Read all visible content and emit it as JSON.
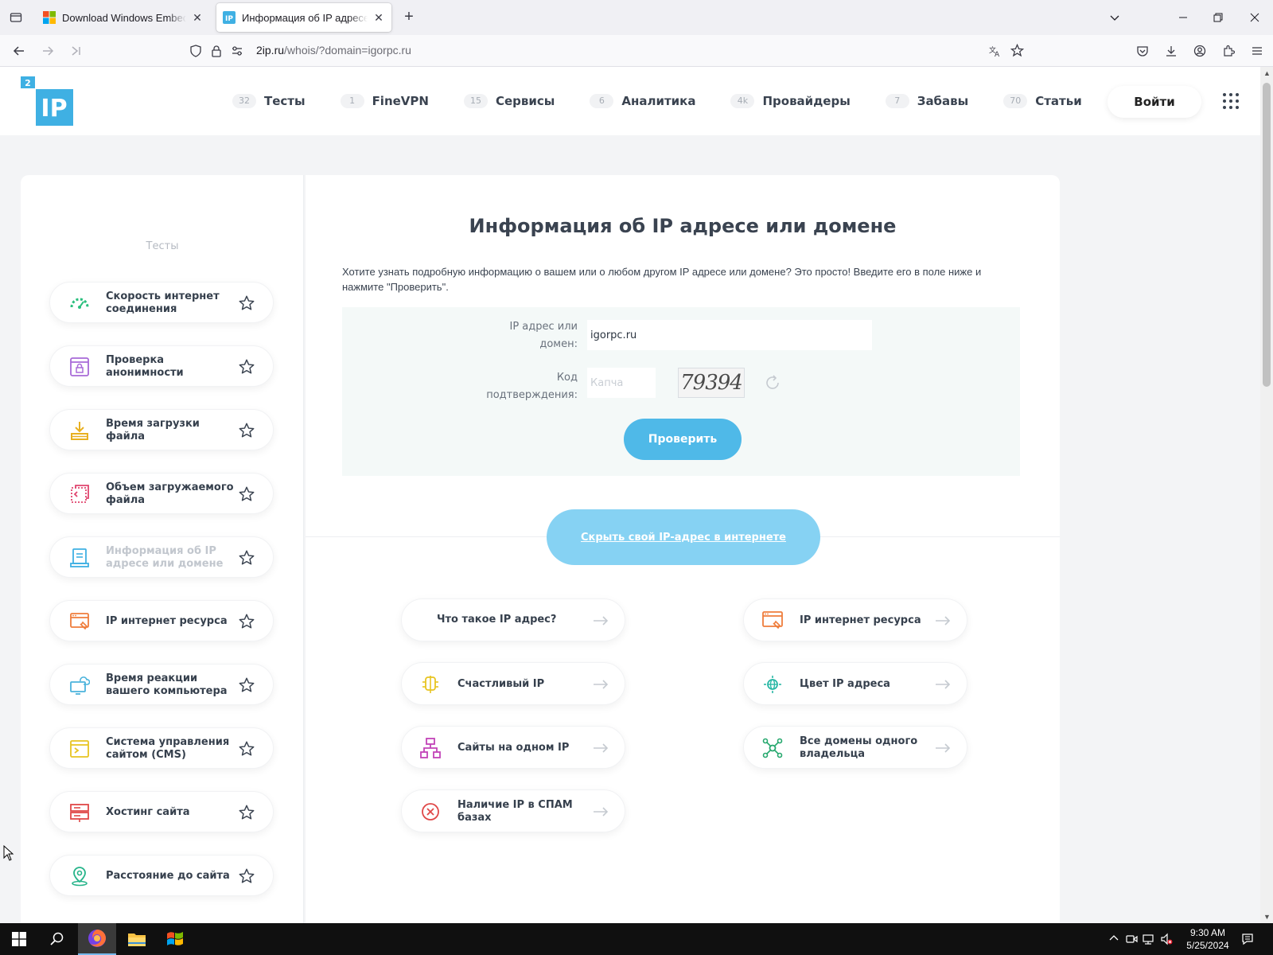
{
  "browser": {
    "tabs": [
      {
        "title": "Download Windows Embedded",
        "favicon": "windows-logo-icon"
      },
      {
        "title": "Информация об IP адресе или",
        "favicon": "2ip-favicon-icon",
        "active": true
      }
    ],
    "url_domain": "2ip.ru",
    "url_path": "/whois/?domain=igorpc.ru"
  },
  "site": {
    "logo_top": "2",
    "logo_main": "IP",
    "nav": [
      {
        "count": "32",
        "label": "Тесты"
      },
      {
        "count": "1",
        "label": "FineVPN"
      },
      {
        "count": "15",
        "label": "Сервисы"
      },
      {
        "count": "6",
        "label": "Аналитика"
      },
      {
        "count": "4k",
        "label": "Провайдеры"
      },
      {
        "count": "7",
        "label": "Забавы"
      },
      {
        "count": "70",
        "label": "Статьи"
      }
    ],
    "login": "Войти"
  },
  "sidebar": {
    "title": "Тесты",
    "items": [
      {
        "label": "Скорость интернет соединения",
        "icon": "speedometer-icon"
      },
      {
        "label": "Проверка анонимности",
        "icon": "lock-window-icon"
      },
      {
        "label": "Время загрузки файла",
        "icon": "download-tray-icon"
      },
      {
        "label": "Объем загружаемого файла",
        "icon": "file-size-icon"
      },
      {
        "label": "Информация об IP адресе или домене",
        "icon": "document-info-icon",
        "active": true
      },
      {
        "label": "IP интернет ресурса",
        "icon": "browser-link-icon"
      },
      {
        "label": "Время реакции вашего компьютера",
        "icon": "computer-cloud-icon"
      },
      {
        "label": "Система управления сайтом (CMS)",
        "icon": "terminal-window-icon"
      },
      {
        "label": "Хостинг сайта",
        "icon": "server-icon"
      },
      {
        "label": "Расстояние до сайта",
        "icon": "map-pin-icon"
      }
    ]
  },
  "main": {
    "title": "Информация об IP адресе или домене",
    "intro": "Хотите узнать подробную информацию о вашем или о любом другом IP адресе или домене? Это просто! Введите его в поле ниже и нажмите \"Проверить\".",
    "form": {
      "ip_label_1": "IP адрес или",
      "ip_label_2": "домен:",
      "ip_value": "igorpc.ru",
      "code_label_1": "Код",
      "code_label_2": "подтверждения:",
      "code_placeholder": "Капча",
      "captcha_text": "79394",
      "submit": "Проверить"
    },
    "hide_ip": "Скрыть свой IP-адрес в интернете",
    "links_left": [
      {
        "label": "Что такое IP адрес?",
        "icon": ""
      },
      {
        "label": "Счастливый IP",
        "icon": "clover-icon"
      },
      {
        "label": "Сайты на одном IP",
        "icon": "sitemap-icon"
      },
      {
        "label": "Наличие IP в СПАМ базах",
        "icon": "blocked-circle-icon"
      }
    ],
    "links_right": [
      {
        "label": "IP интернет ресурса",
        "icon": "browser-link-icon"
      },
      {
        "label": "Цвет IP адреса",
        "icon": "palette-globe-icon"
      },
      {
        "label": "Все домены одного владельца",
        "icon": "network-nodes-icon"
      }
    ]
  },
  "taskbar": {
    "time": "9:30 AM",
    "date": "5/25/2024"
  }
}
